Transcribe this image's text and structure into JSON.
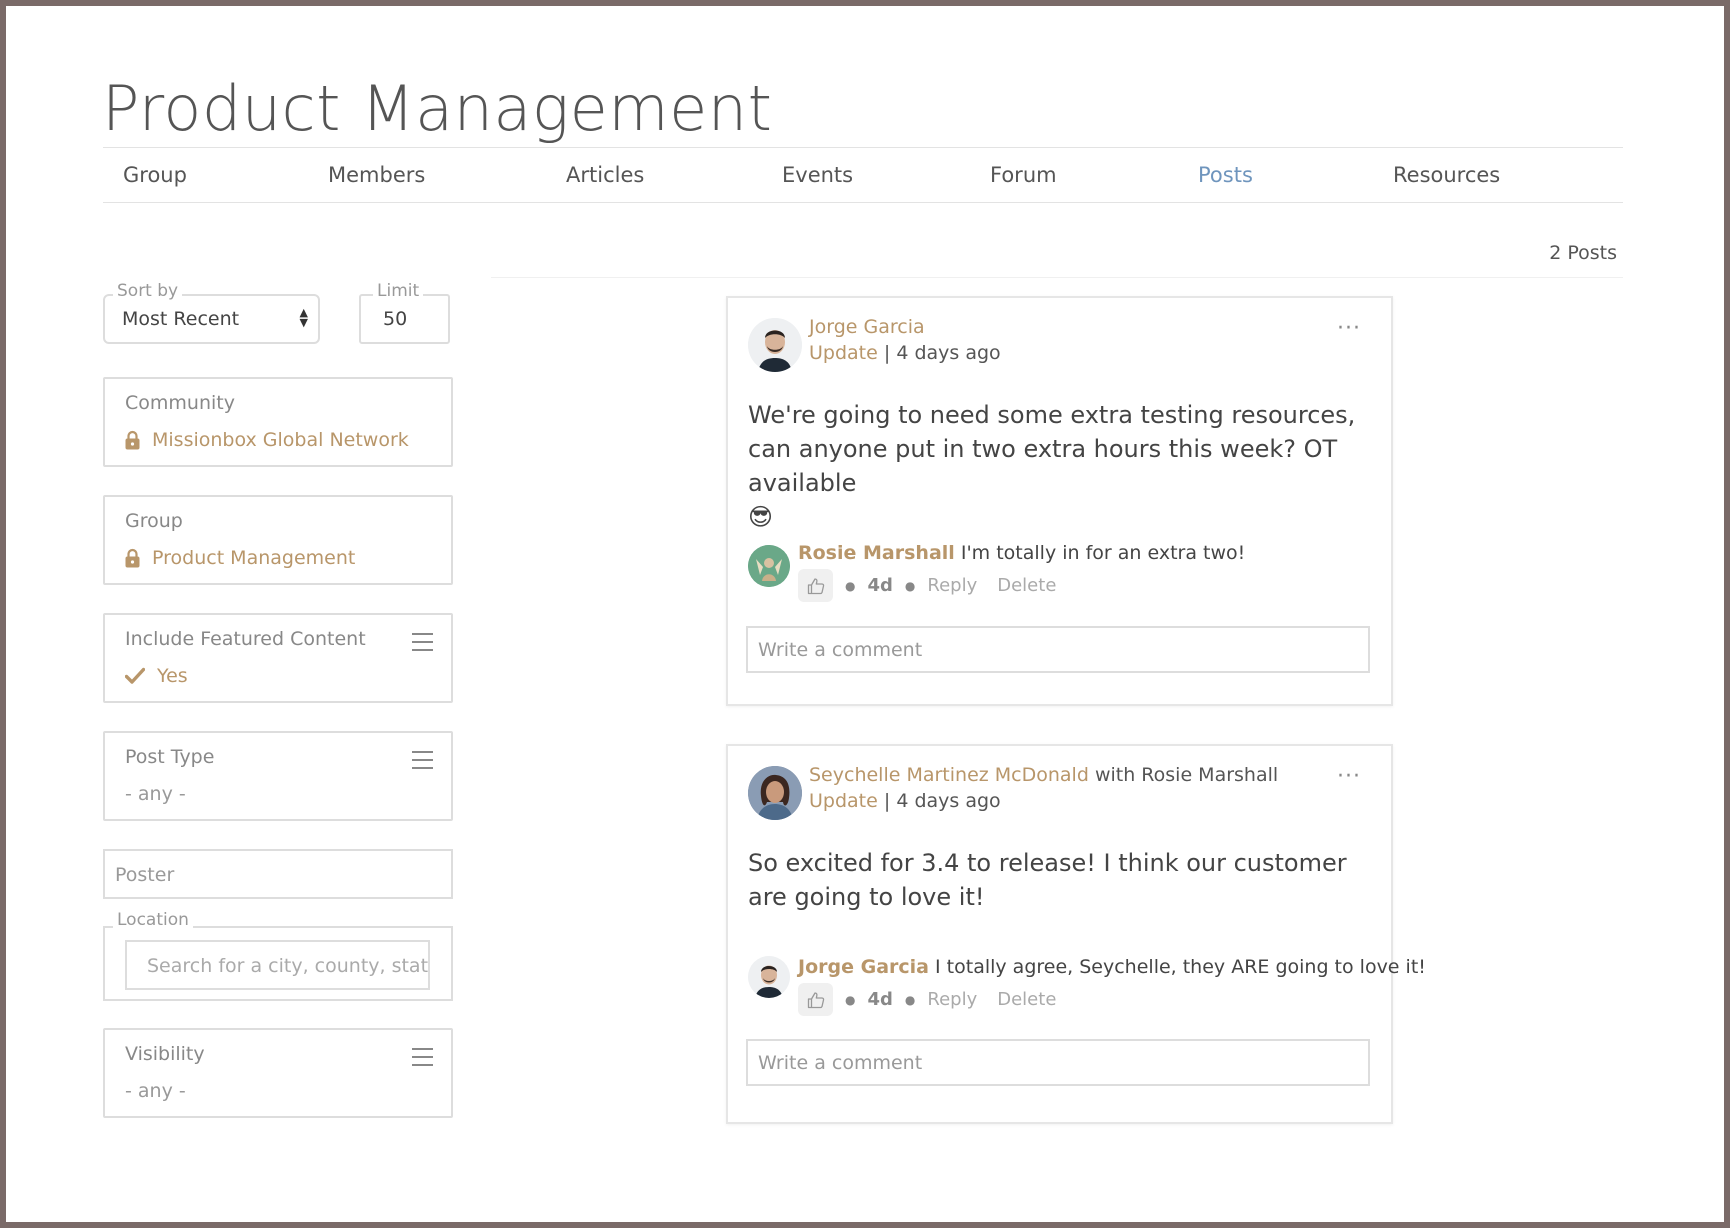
{
  "page": {
    "title": "Product Management"
  },
  "nav": {
    "tabs": [
      {
        "label": "Group"
      },
      {
        "label": "Members"
      },
      {
        "label": "Articles"
      },
      {
        "label": "Events"
      },
      {
        "label": "Forum"
      },
      {
        "label": "Posts",
        "active": true
      },
      {
        "label": "Resources"
      }
    ]
  },
  "post_count": "2 Posts",
  "filters": {
    "sort": {
      "label": "Sort by",
      "value": "Most Recent"
    },
    "limit": {
      "label": "Limit",
      "value": "50"
    },
    "community": {
      "label": "Community",
      "value": "Missionbox Global Network"
    },
    "group": {
      "label": "Group",
      "value": "Product Management"
    },
    "featured": {
      "label": "Include Featured Content",
      "value": "Yes"
    },
    "post_type": {
      "label": "Post Type",
      "value": "- any -"
    },
    "poster": {
      "placeholder": "Poster"
    },
    "location": {
      "label": "Location",
      "placeholder": "Search for a city, county, state"
    },
    "visibility": {
      "label": "Visibility",
      "value": "- any -"
    }
  },
  "posts": [
    {
      "author": "Jorge Garcia",
      "with": "",
      "type": "Update",
      "time": "4 days ago",
      "body": "We're going to need some extra testing resources, can anyone put in two extra hours this week? OT available",
      "emoji": "😎",
      "comment": {
        "author": "Rosie Marshall",
        "text": "I'm totally in for an extra two!",
        "age": "4d",
        "reply": "Reply",
        "delete": "Delete"
      },
      "comment_placeholder": "Write a comment"
    },
    {
      "author": "Seychelle Martinez McDonald",
      "with": "with Rosie Marshall",
      "type": "Update",
      "time": "4 days ago",
      "body": "So excited for 3.4 to release! I think our customer are going to love it!",
      "comment": {
        "author": "Jorge Garcia",
        "text": "I totally agree, Seychelle, they ARE going to love it!",
        "age": "4d",
        "reply": "Reply",
        "delete": "Delete"
      },
      "comment_placeholder": "Write a comment"
    }
  ],
  "colors": {
    "accent": "#b8966a",
    "active_tab": "#6f95bd",
    "border": "#dddddd"
  }
}
